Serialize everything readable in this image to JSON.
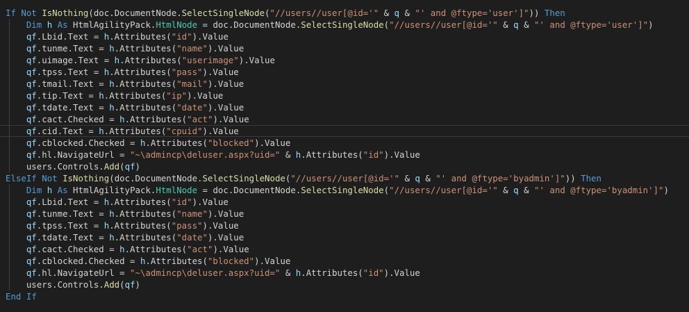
{
  "editor": {
    "language": "vb",
    "theme": {
      "background": "#1e1e1e",
      "keyword": "#569cd6",
      "function": "#dcdcaa",
      "variable": "#9cdcfe",
      "string": "#ce9178",
      "type": "#4ec9b0",
      "text": "#d4d4d4"
    },
    "lines": [
      {
        "current": false,
        "tokens": [
          {
            "t": "If",
            "c": "kw"
          },
          {
            "t": " "
          },
          {
            "t": "Not",
            "c": "kw"
          },
          {
            "t": " "
          },
          {
            "t": "IsNothing",
            "c": "fn"
          },
          {
            "t": "(doc.DocumentNode."
          },
          {
            "t": "SelectSingleNode",
            "c": "fn"
          },
          {
            "t": "("
          },
          {
            "t": "\"//users//user[@id='\"",
            "c": "str"
          },
          {
            "t": " & "
          },
          {
            "t": "q",
            "c": "var"
          },
          {
            "t": " & "
          },
          {
            "t": "\"' and @ftype='user']\"",
            "c": "str"
          },
          {
            "t": ")) "
          },
          {
            "t": "Then",
            "c": "kw"
          }
        ]
      },
      {
        "current": false,
        "tokens": [
          {
            "t": "    "
          },
          {
            "t": "Dim",
            "c": "kw"
          },
          {
            "t": " "
          },
          {
            "t": "h",
            "c": "var"
          },
          {
            "t": " "
          },
          {
            "t": "As",
            "c": "kw"
          },
          {
            "t": " HtmlAgilityPack."
          },
          {
            "t": "HtmlNode",
            "c": "type"
          },
          {
            "t": " = doc.DocumentNode."
          },
          {
            "t": "SelectSingleNode",
            "c": "fn"
          },
          {
            "t": "("
          },
          {
            "t": "\"//users//user[@id='\"",
            "c": "str"
          },
          {
            "t": " & "
          },
          {
            "t": "q",
            "c": "var"
          },
          {
            "t": " & "
          },
          {
            "t": "\"' and @ftype='user']\"",
            "c": "str"
          },
          {
            "t": ")"
          }
        ]
      },
      {
        "current": false,
        "tokens": [
          {
            "t": "    "
          },
          {
            "t": "qf",
            "c": "var"
          },
          {
            "t": ".Lbid.Text = "
          },
          {
            "t": "h",
            "c": "var"
          },
          {
            "t": ".Attributes("
          },
          {
            "t": "\"id\"",
            "c": "str"
          },
          {
            "t": ").Value"
          }
        ]
      },
      {
        "current": false,
        "tokens": [
          {
            "t": "    "
          },
          {
            "t": "qf",
            "c": "var"
          },
          {
            "t": ".tunme.Text = "
          },
          {
            "t": "h",
            "c": "var"
          },
          {
            "t": ".Attributes("
          },
          {
            "t": "\"name\"",
            "c": "str"
          },
          {
            "t": ").Value"
          }
        ]
      },
      {
        "current": false,
        "tokens": [
          {
            "t": "    "
          },
          {
            "t": "qf",
            "c": "var"
          },
          {
            "t": ".uimage.Text = "
          },
          {
            "t": "h",
            "c": "var"
          },
          {
            "t": ".Attributes("
          },
          {
            "t": "\"userimage\"",
            "c": "str"
          },
          {
            "t": ").Value"
          }
        ]
      },
      {
        "current": false,
        "tokens": [
          {
            "t": "    "
          },
          {
            "t": "qf",
            "c": "var"
          },
          {
            "t": ".tpss.Text = "
          },
          {
            "t": "h",
            "c": "var"
          },
          {
            "t": ".Attributes("
          },
          {
            "t": "\"pass\"",
            "c": "str"
          },
          {
            "t": ").Value"
          }
        ]
      },
      {
        "current": false,
        "tokens": [
          {
            "t": "    "
          },
          {
            "t": "qf",
            "c": "var"
          },
          {
            "t": ".tmail.Text = "
          },
          {
            "t": "h",
            "c": "var"
          },
          {
            "t": ".Attributes("
          },
          {
            "t": "\"mail\"",
            "c": "str"
          },
          {
            "t": ").Value"
          }
        ]
      },
      {
        "current": false,
        "tokens": [
          {
            "t": "    "
          },
          {
            "t": "qf",
            "c": "var"
          },
          {
            "t": ".tip.Text = "
          },
          {
            "t": "h",
            "c": "var"
          },
          {
            "t": ".Attributes("
          },
          {
            "t": "\"ip\"",
            "c": "str"
          },
          {
            "t": ").Value"
          }
        ]
      },
      {
        "current": false,
        "tokens": [
          {
            "t": "    "
          },
          {
            "t": "qf",
            "c": "var"
          },
          {
            "t": ".tdate.Text = "
          },
          {
            "t": "h",
            "c": "var"
          },
          {
            "t": ".Attributes("
          },
          {
            "t": "\"date\"",
            "c": "str"
          },
          {
            "t": ").Value"
          }
        ]
      },
      {
        "current": false,
        "tokens": [
          {
            "t": "    "
          },
          {
            "t": "qf",
            "c": "var"
          },
          {
            "t": ".cact.Checked = "
          },
          {
            "t": "h",
            "c": "var"
          },
          {
            "t": ".Attributes("
          },
          {
            "t": "\"act\"",
            "c": "str"
          },
          {
            "t": ").Value"
          }
        ]
      },
      {
        "current": true,
        "tokens": [
          {
            "t": "    "
          },
          {
            "t": "qf",
            "c": "var"
          },
          {
            "t": ".cid.Text = "
          },
          {
            "t": "h",
            "c": "var"
          },
          {
            "t": ".Attributes("
          },
          {
            "t": "\"cpuid\"",
            "c": "str"
          },
          {
            "t": ").Value"
          }
        ]
      },
      {
        "current": false,
        "tokens": [
          {
            "t": "    "
          },
          {
            "t": "qf",
            "c": "var"
          },
          {
            "t": ".cblocked.Checked = "
          },
          {
            "t": "h",
            "c": "var"
          },
          {
            "t": ".Attributes("
          },
          {
            "t": "\"blocked\"",
            "c": "str"
          },
          {
            "t": ").Value"
          }
        ]
      },
      {
        "current": false,
        "tokens": [
          {
            "t": "    "
          },
          {
            "t": "qf",
            "c": "var"
          },
          {
            "t": ".hl.NavigateUrl = "
          },
          {
            "t": "\"~\\admincp\\deluser.aspx?uid=\"",
            "c": "str"
          },
          {
            "t": " & "
          },
          {
            "t": "h",
            "c": "var"
          },
          {
            "t": ".Attributes("
          },
          {
            "t": "\"id\"",
            "c": "str"
          },
          {
            "t": ").Value"
          }
        ]
      },
      {
        "current": false,
        "tokens": [
          {
            "t": "    users.Controls."
          },
          {
            "t": "Add",
            "c": "fn"
          },
          {
            "t": "("
          },
          {
            "t": "qf",
            "c": "var"
          },
          {
            "t": ")"
          }
        ]
      },
      {
        "current": false,
        "tokens": [
          {
            "t": "ElseIf",
            "c": "kw"
          },
          {
            "t": " "
          },
          {
            "t": "Not",
            "c": "kw"
          },
          {
            "t": " "
          },
          {
            "t": "IsNothing",
            "c": "fn"
          },
          {
            "t": "(doc.DocumentNode."
          },
          {
            "t": "SelectSingleNode",
            "c": "fn"
          },
          {
            "t": "("
          },
          {
            "t": "\"//users//user[@id='\"",
            "c": "str"
          },
          {
            "t": " & "
          },
          {
            "t": "q",
            "c": "var"
          },
          {
            "t": " & "
          },
          {
            "t": "\"' and @ftype='byadmin']\"",
            "c": "str"
          },
          {
            "t": ")) "
          },
          {
            "t": "Then",
            "c": "kw"
          }
        ]
      },
      {
        "current": false,
        "tokens": [
          {
            "t": "    "
          },
          {
            "t": "Dim",
            "c": "kw"
          },
          {
            "t": " "
          },
          {
            "t": "h",
            "c": "var"
          },
          {
            "t": " "
          },
          {
            "t": "As",
            "c": "kw"
          },
          {
            "t": " HtmlAgilityPack."
          },
          {
            "t": "HtmlNode",
            "c": "type"
          },
          {
            "t": " = doc.DocumentNode."
          },
          {
            "t": "SelectSingleNode",
            "c": "fn"
          },
          {
            "t": "("
          },
          {
            "t": "\"//users//user[@id='\"",
            "c": "str"
          },
          {
            "t": " & "
          },
          {
            "t": "q",
            "c": "var"
          },
          {
            "t": " & "
          },
          {
            "t": "\"' and @ftype='byadmin']\"",
            "c": "str"
          },
          {
            "t": ")"
          }
        ]
      },
      {
        "current": false,
        "tokens": [
          {
            "t": "    "
          },
          {
            "t": "qf",
            "c": "var"
          },
          {
            "t": ".Lbid.Text = "
          },
          {
            "t": "h",
            "c": "var"
          },
          {
            "t": ".Attributes("
          },
          {
            "t": "\"id\"",
            "c": "str"
          },
          {
            "t": ").Value"
          }
        ]
      },
      {
        "current": false,
        "tokens": [
          {
            "t": "    "
          },
          {
            "t": "qf",
            "c": "var"
          },
          {
            "t": ".tunme.Text = "
          },
          {
            "t": "h",
            "c": "var"
          },
          {
            "t": ".Attributes("
          },
          {
            "t": "\"name\"",
            "c": "str"
          },
          {
            "t": ").Value"
          }
        ]
      },
      {
        "current": false,
        "tokens": [
          {
            "t": "    "
          },
          {
            "t": "qf",
            "c": "var"
          },
          {
            "t": ".tpss.Text = "
          },
          {
            "t": "h",
            "c": "var"
          },
          {
            "t": ".Attributes("
          },
          {
            "t": "\"pass\"",
            "c": "str"
          },
          {
            "t": ").Value"
          }
        ]
      },
      {
        "current": false,
        "tokens": [
          {
            "t": "    "
          },
          {
            "t": "qf",
            "c": "var"
          },
          {
            "t": ".tdate.Text = "
          },
          {
            "t": "h",
            "c": "var"
          },
          {
            "t": ".Attributes("
          },
          {
            "t": "\"date\"",
            "c": "str"
          },
          {
            "t": ").Value"
          }
        ]
      },
      {
        "current": false,
        "tokens": [
          {
            "t": "    "
          },
          {
            "t": "qf",
            "c": "var"
          },
          {
            "t": ".cact.Checked = "
          },
          {
            "t": "h",
            "c": "var"
          },
          {
            "t": ".Attributes("
          },
          {
            "t": "\"act\"",
            "c": "str"
          },
          {
            "t": ").Value"
          }
        ]
      },
      {
        "current": false,
        "tokens": [
          {
            "t": "    "
          },
          {
            "t": "qf",
            "c": "var"
          },
          {
            "t": ".cblocked.Checked = "
          },
          {
            "t": "h",
            "c": "var"
          },
          {
            "t": ".Attributes("
          },
          {
            "t": "\"blocked\"",
            "c": "str"
          },
          {
            "t": ").Value"
          }
        ]
      },
      {
        "current": false,
        "tokens": [
          {
            "t": "    "
          },
          {
            "t": "qf",
            "c": "var"
          },
          {
            "t": ".hl.NavigateUrl = "
          },
          {
            "t": "\"~\\admincp\\deluser.aspx?uid=\"",
            "c": "str"
          },
          {
            "t": " & "
          },
          {
            "t": "h",
            "c": "var"
          },
          {
            "t": ".Attributes("
          },
          {
            "t": "\"id\"",
            "c": "str"
          },
          {
            "t": ").Value"
          }
        ]
      },
      {
        "current": false,
        "tokens": [
          {
            "t": "    users.Controls."
          },
          {
            "t": "Add",
            "c": "fn"
          },
          {
            "t": "("
          },
          {
            "t": "qf",
            "c": "var"
          },
          {
            "t": ")"
          }
        ]
      },
      {
        "current": false,
        "tokens": [
          {
            "t": "End",
            "c": "kw"
          },
          {
            "t": " "
          },
          {
            "t": "If",
            "c": "kw"
          }
        ]
      }
    ]
  }
}
